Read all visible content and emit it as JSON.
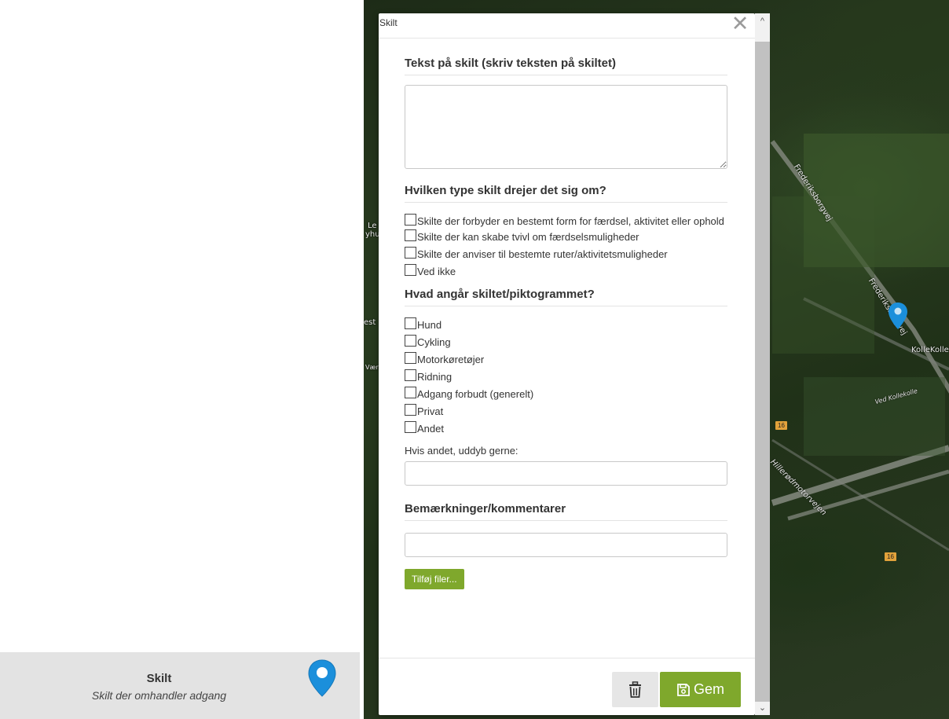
{
  "legend_card": {
    "title": "Skilt",
    "subtitle": "Skilt der omhandler adgang",
    "pin_color": "#1b8fdb"
  },
  "map": {
    "labels": {
      "road_1": "Frederiksborgvej",
      "road_2": "Frederiksborgvej",
      "place_1": "KolleKolle",
      "road_3": "Ved Kollekolle",
      "road_4": "Hillerødmotorvejen",
      "edge_1": "Le",
      "edge_2": "yhu",
      "edge_3": "est",
      "edge_4": "Værl"
    },
    "shields": {
      "shield_1": "16",
      "shield_2": "16"
    }
  },
  "modal": {
    "title": "Skilt",
    "close_glyph": "✕",
    "section_sign_text": {
      "heading": "Tekst på skilt (skriv teksten på skiltet)",
      "value": ""
    },
    "section_type": {
      "heading": "Hvilken type skilt drejer det sig om?",
      "options": [
        {
          "label": "Skilte der forbyder en bestemt form for færdsel, aktivitet eller ophold",
          "checked": false
        },
        {
          "label": "Skilte der kan skabe tvivl om færdselsmuligheder",
          "checked": false
        },
        {
          "label": "Skilte der anviser til bestemte ruter/aktivitetsmuligheder",
          "checked": false
        },
        {
          "label": "Ved ikke",
          "checked": false
        }
      ]
    },
    "section_subject": {
      "heading": "Hvad angår skiltet/piktogrammet?",
      "options": [
        {
          "label": "Hund",
          "checked": false
        },
        {
          "label": "Cykling",
          "checked": false
        },
        {
          "label": "Motorkøretøjer",
          "checked": false
        },
        {
          "label": "Ridning",
          "checked": false
        },
        {
          "label": "Adgang forbudt (generelt)",
          "checked": false
        },
        {
          "label": "Privat",
          "checked": false
        },
        {
          "label": "Andet",
          "checked": false
        }
      ],
      "other_label": "Hvis andet, uddyb gerne:",
      "other_value": ""
    },
    "section_comments": {
      "heading": "Bemærkninger/kommentarer",
      "value": ""
    },
    "add_files_label": "Tilføj filer...",
    "save_label": "Gem",
    "accent_color": "#7fa82c"
  }
}
